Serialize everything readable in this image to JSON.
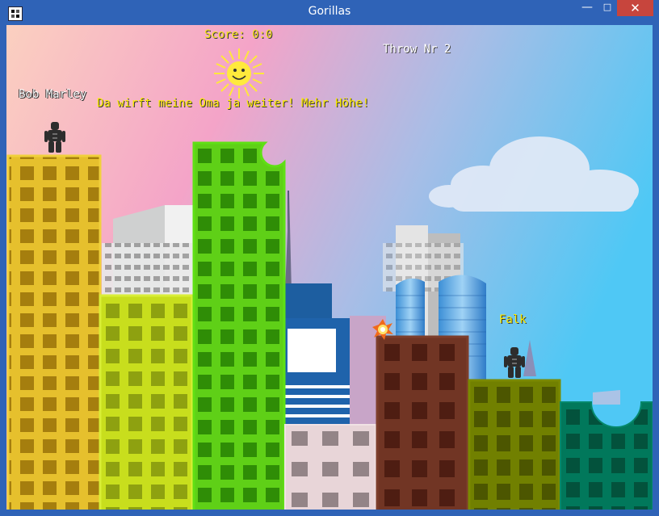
{
  "window": {
    "title": "Gorillas",
    "controls": {
      "minimize": "—",
      "maximize": "□",
      "close": "✕"
    }
  },
  "hud": {
    "score": "Score: 0:0",
    "throw": "Throw Nr 2"
  },
  "players": {
    "left": {
      "name": "Bob Marley"
    },
    "right": {
      "name": "Falk"
    }
  },
  "taunt": "Da wirft meine Oma ja weiter! Mehr Höhe!",
  "colors": {
    "sky_left": "#f9c7c0",
    "sky_mid": "#f5a3c8",
    "sky_right": "#5cc7f3",
    "sun": "#ffe93b",
    "building_yellow": "#e8c22c",
    "building_lime": "#c4dc1e",
    "building_green": "#59cc12",
    "building_pink_gray": "#e6d3d6",
    "building_brown": "#6f3523",
    "building_olive": "#6f7f00",
    "building_teal": "#00765a"
  }
}
